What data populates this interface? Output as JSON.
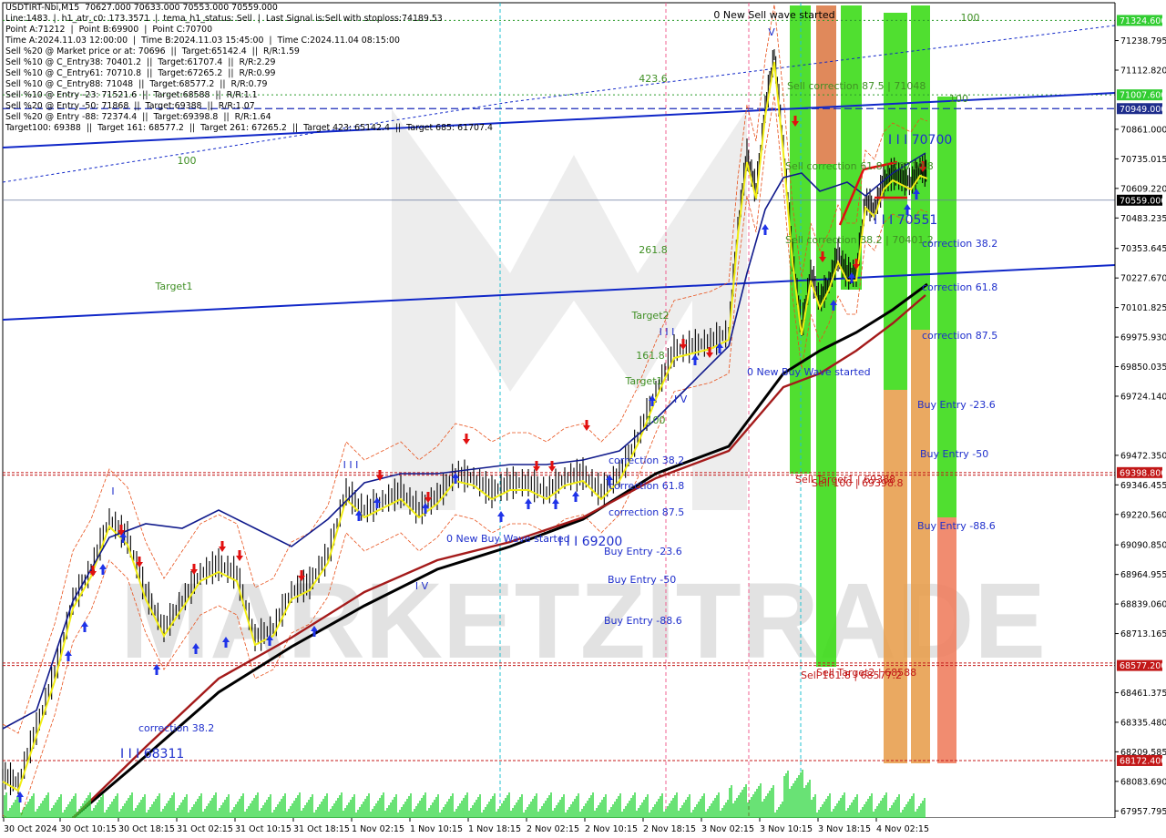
{
  "header_lines": [
    "USDTIRT-Nbi,M15  70627.000 70633.000 70553.000 70559.000",
    "Line:1483  |  h1_atr_c0: 173.3571  |  tema_h1_status: Sell  |  Last Signal is:Sell with stoploss:74189.53",
    "Point A:71212  |  Point B:69900  |  Point C:70700",
    "Time A:2024.11.03 12:00:00  |  Time B:2024.11.03 15:45:00  |  Time C:2024.11.04 08:15:00",
    "Sell %20 @ Market price or at: 70696  ||  Target:65142.4  ||  R/R:1.59",
    "Sell %10 @ C_Entry38: 70401.2  ||  Target:61707.4  ||  R/R:2.29",
    "Sell %10 @ C_Entry61: 70710.8  ||  Target:67265.2  ||  R/R:0.99",
    "Sell %10 @ C_Entry88: 71048  ||  Target:68577.2  ||  R/R:0.79",
    "Sell %10 @ Entry -23: 71521.6  ||  Target:68588  ||  R/R:1.1",
    "Sell %20 @ Entry -50: 71868  ||  Target:69388  ||  R/R:1.07",
    "Sell %20 @ Entry -88: 72374.4  ||  Target:69398.8  ||  R/R:1.64",
    "Target100: 69388  ||  Target 161: 68577.2  ||  Target 261: 67265.2  ||  Target 423: 65142.4  ||  Target 685: 61707.4"
  ],
  "colors": {
    "background": "#ffffff",
    "candle": "#000000",
    "yellow_line": "#f2ee12",
    "navy_ma": "#101a8c",
    "black_ma": "#000000",
    "red_ma": "#a41a1a",
    "trend_blue": "#1027c8",
    "bands_orange": "#e8501a",
    "green_zone": "#3ddc1a",
    "orange_zone": "#e8a050",
    "salmon_zone": "#f08060",
    "volume": "#29d63a",
    "buy_arrow": "#1f33e8",
    "sell_arrow": "#e21010",
    "label_green": "#3f8f24",
    "label_blue": "#1f2fcc",
    "label_red": "#c21818",
    "price_tag_green": "#32cd32",
    "price_tag_red": "#c21818",
    "price_tag_navy": "#1e2d8c"
  },
  "watermark": "MARKETZITRADE",
  "chart_data": {
    "type": "candlestick",
    "symbol": "USDTIRT-Nbi",
    "timeframe": "M15",
    "ohlc_last": {
      "open": 70627.0,
      "high": 70633.0,
      "low": 70553.0,
      "close": 70559.0
    },
    "ylim": [
      67927.8,
      71400.0
    ],
    "y_ticks": [
      71238.795,
      71112.82,
      70861.0,
      70735.015,
      70609.22,
      70483.235,
      70353.645,
      70227.67,
      70101.825,
      69975.93,
      69850.035,
      69724.14,
      69472.35,
      69346.455,
      69220.56,
      69090.85,
      68964.955,
      68839.06,
      68713.165,
      68461.375,
      68335.48,
      68209.585,
      68083.69,
      67957.795
    ],
    "x_tick_labels": [
      "30 Oct 2024",
      "30 Oct 10:15",
      "30 Oct 18:15",
      "31 Oct 02:15",
      "31 Oct 10:15",
      "31 Oct 18:15",
      "1 Nov 02:15",
      "1 Nov 10:15",
      "1 Nov 18:15",
      "2 Nov 02:15",
      "2 Nov 10:15",
      "2 Nov 18:15",
      "3 Nov 02:15",
      "3 Nov 10:15",
      "3 Nov 18:15",
      "4 Nov 02:15"
    ],
    "price_tags": [
      {
        "value": 71324.6,
        "label": "71324.600",
        "kind": "green"
      },
      {
        "value": 71007.6,
        "label": "71007.600",
        "kind": "green"
      },
      {
        "value": 70949.0,
        "label": "70949.000",
        "kind": "navy"
      },
      {
        "value": 70559.0,
        "label": "70559.000",
        "kind": "current"
      },
      {
        "value": 69398.8,
        "label": "69398.800",
        "kind": "red"
      },
      {
        "value": 68577.2,
        "label": "68577.200",
        "kind": "red"
      },
      {
        "value": 68172.4,
        "label": "68172.400",
        "kind": "red"
      }
    ],
    "horizontal_levels": [
      {
        "value": 71324.6,
        "style": "green-dotted"
      },
      {
        "value": 71007.6,
        "style": "green-dotted"
      },
      {
        "value": 70949.0,
        "style": "navy-dashed"
      },
      {
        "value": 70559.0,
        "style": "gray-solid"
      },
      {
        "value": 69398.8,
        "style": "red-dashed"
      },
      {
        "value": 69388.0,
        "style": "red-dashed"
      },
      {
        "value": 68588.0,
        "style": "red-dashed"
      },
      {
        "value": 68577.2,
        "style": "red-dashed"
      },
      {
        "value": 68172.4,
        "style": "red-dashed"
      }
    ],
    "annotations": [
      {
        "text": "0 New Sell wave started",
        "kind": "black"
      },
      {
        "text": "100",
        "kind": "green"
      },
      {
        "text": "423.6",
        "kind": "green"
      },
      {
        "text": "100",
        "kind": "green"
      },
      {
        "text": "Target1",
        "kind": "green"
      },
      {
        "text": "261.8",
        "kind": "green"
      },
      {
        "text": "Target2",
        "kind": "green"
      },
      {
        "text": "161.8",
        "kind": "green"
      },
      {
        "text": "Target1",
        "kind": "green"
      },
      {
        "text": "100",
        "kind": "green"
      },
      {
        "text": "Sell correction 87.5 | 71048",
        "kind": "green"
      },
      {
        "text": "Sell correction 61.8 | 70710.8",
        "kind": "green"
      },
      {
        "text": "Sell correction 38.2 | 70401.2",
        "kind": "green"
      },
      {
        "text": "I I I 70700",
        "kind": "blue"
      },
      {
        "text": "I I I 70551",
        "kind": "blue"
      },
      {
        "text": "correction 38.2",
        "kind": "blue"
      },
      {
        "text": "correction 61.8",
        "kind": "blue"
      },
      {
        "text": "correction 87.5",
        "kind": "blue"
      },
      {
        "text": "Buy Entry -23.6",
        "kind": "blue"
      },
      {
        "text": "Buy Entry -50",
        "kind": "blue"
      },
      {
        "text": "Buy Entry -88.6",
        "kind": "blue"
      },
      {
        "text": "0 New Buy Wave started",
        "kind": "blue"
      },
      {
        "text": "I V",
        "kind": "blue"
      },
      {
        "text": "correction 38.2",
        "kind": "blue"
      },
      {
        "text": "correction 61.8",
        "kind": "blue"
      },
      {
        "text": "correction 87.5",
        "kind": "blue"
      },
      {
        "text": "0 New Buy Wave started",
        "kind": "blue"
      },
      {
        "text": "I I I 69200",
        "kind": "blue"
      },
      {
        "text": "Buy Entry -23.6",
        "kind": "blue"
      },
      {
        "text": "Buy Entry -50",
        "kind": "blue"
      },
      {
        "text": "Buy Entry -88.6",
        "kind": "blue"
      },
      {
        "text": "correction 38.2",
        "kind": "blue"
      },
      {
        "text": "I I I 68311",
        "kind": "blue"
      },
      {
        "text": "Sell Target1 | 69388",
        "kind": "red"
      },
      {
        "text": "Sell 100 | 69398.8",
        "kind": "red"
      },
      {
        "text": "Sell 161.8 | 68577.2",
        "kind": "red"
      },
      {
        "text": "Sell Target2 | 68588",
        "kind": "red"
      },
      {
        "text": "V",
        "kind": "blue"
      },
      {
        "text": "I I I",
        "kind": "blue"
      },
      {
        "text": "I I I",
        "kind": "blue"
      },
      {
        "text": "I",
        "kind": "blue"
      },
      {
        "text": "I V",
        "kind": "blue"
      },
      {
        "text": "100",
        "kind": "green"
      }
    ]
  }
}
